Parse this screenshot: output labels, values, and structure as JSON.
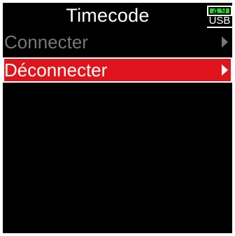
{
  "header": {
    "title": "Timecode"
  },
  "battery": {
    "value": "4.9",
    "source": "USB",
    "color": "#2bd12b"
  },
  "menu": {
    "items": [
      {
        "label": "Connecter",
        "state": "disabled"
      },
      {
        "label": "Déconnecter",
        "state": "selected"
      }
    ],
    "selected_color": "#e0141c",
    "disabled_color": "#777777"
  }
}
